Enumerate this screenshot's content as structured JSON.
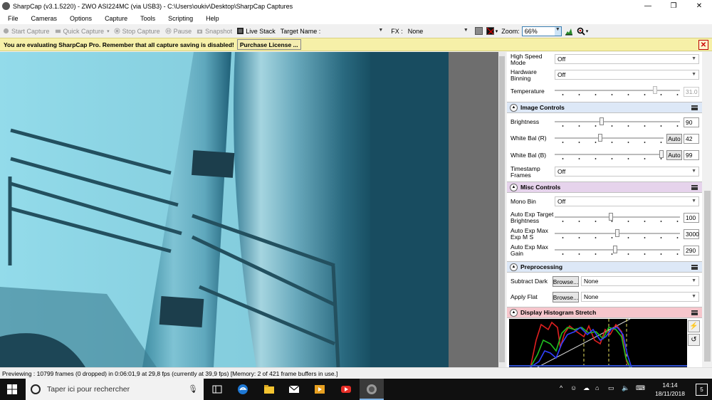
{
  "window": {
    "title": "SharpCap (v3.1.5220) - ZWO ASI224MC (via USB3) - C:\\Users\\oukiv\\Desktop\\SharpCap Captures",
    "minimize": "—",
    "maximize": "❐",
    "close": "✕"
  },
  "menu": [
    "File",
    "Cameras",
    "Options",
    "Capture",
    "Tools",
    "Scripting",
    "Help"
  ],
  "toolbar": {
    "start_capture": "Start Capture",
    "quick_capture": "Quick Capture",
    "stop_capture": "Stop Capture",
    "pause": "Pause",
    "snapshot": "Snapshot",
    "live_stack": "Live Stack",
    "target_name_label": "Target Name :",
    "target_name_value": "",
    "fx_label": "FX :",
    "fx_value": "None",
    "zoom_label": "Zoom:",
    "zoom_value": "66%"
  },
  "eval": {
    "message": "You are evaluating SharpCap Pro. Remember that all capture saving is disabled!",
    "purchase": "Purchase License ...",
    "close": "✕"
  },
  "panel": {
    "high_speed_mode": {
      "label": "High Speed Mode",
      "value": "Off"
    },
    "hardware_binning": {
      "label": "Hardware Binning",
      "value": "Off"
    },
    "temperature": {
      "label": "Temperature",
      "value": "31.0"
    },
    "image_controls": {
      "title": "Image Controls",
      "brightness": {
        "label": "Brightness",
        "value": "90"
      },
      "white_bal_r": {
        "label": "White Bal (R)",
        "value": "42",
        "auto": "Auto"
      },
      "white_bal_b": {
        "label": "White Bal (B)",
        "value": "99",
        "auto": "Auto"
      },
      "timestamp_frames": {
        "label": "Timestamp Frames",
        "value": "Off"
      }
    },
    "misc_controls": {
      "title": "Misc Controls",
      "mono_bin": {
        "label": "Mono Bin",
        "value": "Off"
      },
      "auto_exp_target": {
        "label": "Auto Exp Target Brightness",
        "value": "100"
      },
      "auto_exp_max_exp": {
        "label": "Auto Exp Max Exp M S",
        "value": "3000"
      },
      "auto_exp_max_gain": {
        "label": "Auto Exp Max Gain",
        "value": "290"
      }
    },
    "preprocessing": {
      "title": "Preprocessing",
      "subtract_dark": {
        "label": "Subtract Dark",
        "browse": "Browse...",
        "value": "None"
      },
      "apply_flat": {
        "label": "Apply Flat",
        "browse": "Browse...",
        "value": "None"
      }
    },
    "histogram": {
      "title": "Display Histogram Stretch"
    }
  },
  "status": "Previewing : 10799 frames (0 dropped) in 0:06:01,9 at 29,8 fps  (currently at 39,9 fps) [Memory: 2 of 421 frame buffers in use.]",
  "taskbar": {
    "search_placeholder": "Taper ici pour rechercher",
    "time": "14:14",
    "date": "18/11/2018",
    "notifications": "5"
  },
  "colors": {
    "eval_bg": "#f6f0a8",
    "image_controls_header": "#dde8f7",
    "misc_controls_header": "#e6d3ec",
    "preprocessing_header": "#dde8f7",
    "histogram_header": "#f6c6cc"
  }
}
